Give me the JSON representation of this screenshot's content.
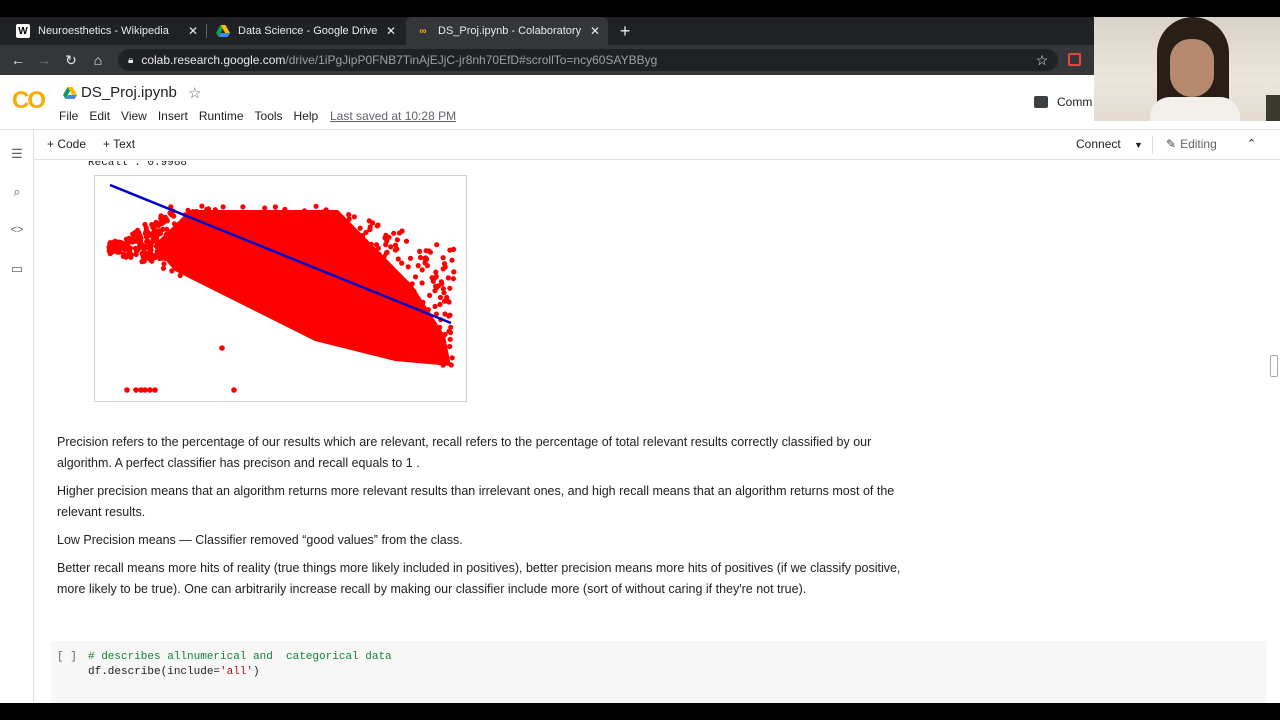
{
  "browser": {
    "tabs": [
      {
        "title": "Neuroesthetics - Wikipedia",
        "icon": "wikipedia-icon"
      },
      {
        "title": "Data Science - Google Drive",
        "icon": "google-drive-icon"
      },
      {
        "title": "DS_Proj.ipynb - Colaboratory",
        "icon": "colab-icon"
      }
    ],
    "close_glyph": "✕",
    "new_tab_glyph": "+",
    "url_host": "colab.research.google.com",
    "url_path": "/drive/1iPgJipP0FNB7TinAjEJjC-jr8nh70EfD#scrollTo=ncy60SAYBByg"
  },
  "colab": {
    "logo": "CO",
    "notebook_title": "DS_Proj.ipynb",
    "menu": [
      "File",
      "Edit",
      "View",
      "Insert",
      "Runtime",
      "Tools",
      "Help"
    ],
    "last_saved": "Last saved at 10:28 PM",
    "comment_label": "Comm",
    "toolbar": {
      "add_code": "+ Code",
      "add_text": "+ Text",
      "connect": "Connect",
      "editing": "Editing"
    }
  },
  "output": {
    "recall_line": "Recall : 0.9988"
  },
  "markdown": [
    "Precision refers to the percentage of our results which are relevant, recall refers to the percentage of total relevant results correctly classified by our algorithm. A perfect classifier has precison and recall equals to 1 .",
    "Higher precision means that an algorithm returns more relevant results than irrelevant ones, and high recall means that an algorithm returns most of the relevant results.",
    "Low Precision means — Classifier removed “good values” from the class.",
    "Better recall means more hits of reality (true things more likely included in positives), better precision means more hits of positives (if we classify positive, more likely to be true). One can arbitrarily increase recall by making our classifier include more (sort of without caring if they're not true)."
  ],
  "code_cell": {
    "prompt": "[ ]",
    "comment": "# describes allnumerical and  categorical data",
    "code_prefix": "df.describe(include=",
    "code_string": "'all'",
    "code_suffix": ")"
  },
  "colors": {
    "scatter": "#ff0000",
    "regression_line": "#0000cc",
    "colab_orange": "#f9ab00"
  }
}
